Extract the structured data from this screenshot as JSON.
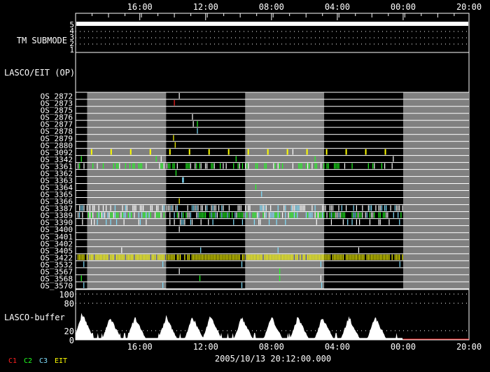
{
  "chart_data": {
    "type": "timeline",
    "x_unit": "hours from plot start",
    "xlim": [
      0,
      23.9
    ],
    "time_ticks": [
      {
        "label": "16:00",
        "hours": 3.9
      },
      {
        "label": "12:00",
        "hours": 7.9
      },
      {
        "label": "08:00",
        "hours": 11.9
      },
      {
        "label": "04:00",
        "hours": 15.9
      },
      {
        "label": "00:00",
        "hours": 19.9
      },
      {
        "label": "20:00",
        "hours": 23.9
      }
    ],
    "footer_time": "2005/10/13 20:12:00.000",
    "legend": [
      {
        "label": "C1",
        "color": "#ff2020"
      },
      {
        "label": "C2",
        "color": "#20ff20"
      },
      {
        "label": "C3",
        "color": "#80e0ff"
      },
      {
        "label": "EIT",
        "color": "#ffff00"
      }
    ],
    "shaded_intervals": [
      [
        0.7,
        5.5
      ],
      [
        10.3,
        15.1
      ],
      [
        19.9,
        23.9
      ]
    ],
    "submode": {
      "label": "TM SUBMODE",
      "ticks": [
        "5",
        "4",
        "3",
        "2",
        "1"
      ],
      "value": 5
    },
    "op_label": "LASCO/EIT (OP)",
    "rows": [
      {
        "name": "OS_2872",
        "events": [
          [
            6.3,
            "#ffffff"
          ]
        ]
      },
      {
        "name": "OS_2873",
        "events": [
          [
            6.0,
            "#ff2020"
          ]
        ]
      },
      {
        "name": "OS_2875",
        "events": []
      },
      {
        "name": "OS_2876",
        "events": [
          [
            7.1,
            "#ffffff"
          ]
        ]
      },
      {
        "name": "OS_2877",
        "events": [
          [
            7.4,
            "#20ff20"
          ],
          [
            7.15,
            "#ffffff"
          ]
        ]
      },
      {
        "name": "OS_2878",
        "events": [
          [
            7.4,
            "#80e0ff"
          ]
        ]
      },
      {
        "name": "OS_2879",
        "events": [
          [
            5.95,
            "#ffff00"
          ]
        ]
      },
      {
        "name": "OS_2880",
        "events": [
          [
            6.05,
            "#ffff00"
          ]
        ]
      },
      {
        "name": "OS_3092",
        "periodic": {
          "start": 0.97,
          "step": 1.19,
          "end": 19.0,
          "color": "#ffff00"
        },
        "events": [
          [
            4.55,
            "#ffffff"
          ],
          [
            13.2,
            "#ffffff"
          ]
        ]
      },
      {
        "name": "OS_3342",
        "events": [
          [
            0.35,
            "#20ff20"
          ],
          [
            4.9,
            "#20ff20"
          ],
          [
            5.2,
            "#ffffff"
          ],
          [
            9.75,
            "#20ff20"
          ],
          [
            14.55,
            "#20ff20"
          ],
          [
            19.3,
            "#ffffff"
          ]
        ]
      },
      {
        "name": "OS_3361",
        "dense": {
          "end": 19.4,
          "density": 0.45,
          "colors": [
            "#20ff20",
            "#20ff20",
            "#ffffff"
          ]
        }
      },
      {
        "name": "OS_3362",
        "events": [
          [
            6.1,
            "#20ff20"
          ]
        ]
      },
      {
        "name": "OS_3363",
        "events": [
          [
            6.5,
            "#80e0ff"
          ],
          [
            6.55,
            "#80e0ff"
          ]
        ]
      },
      {
        "name": "OS_3364",
        "events": [
          [
            10.95,
            "#20ff20"
          ]
        ]
      },
      {
        "name": "OS_3365",
        "events": [
          [
            11.3,
            "#80e0ff"
          ]
        ]
      },
      {
        "name": "OS_3366",
        "events": [
          [
            6.3,
            "#ffff00"
          ]
        ]
      },
      {
        "name": "OS_3387",
        "dense": {
          "end": 19.9,
          "density": 0.55,
          "colors": [
            "#ffffff",
            "#80e0ff",
            "#ffffff"
          ]
        }
      },
      {
        "name": "OS_3389",
        "dense": {
          "end": 19.9,
          "density": 0.7,
          "colors": [
            "#20ff20",
            "#20ff20",
            "#80e0ff",
            "#ffffff"
          ]
        }
      },
      {
        "name": "OS_3390",
        "dense": {
          "end": 19.9,
          "density": 0.2,
          "colors": [
            "#80e0ff",
            "#ffffff"
          ]
        }
      },
      {
        "name": "OS_3400",
        "events": [
          [
            6.3,
            "#ffffff"
          ]
        ]
      },
      {
        "name": "OS_3401",
        "events": []
      },
      {
        "name": "OS_3402",
        "events": []
      },
      {
        "name": "OS_3405",
        "events": [
          [
            2.8,
            "#ffffff"
          ],
          [
            7.6,
            "#80e0ff"
          ],
          [
            12.3,
            "#80e0ff"
          ],
          [
            17.2,
            "#ffffff"
          ]
        ]
      },
      {
        "name": "OS_3422",
        "dense": {
          "end": 19.9,
          "density": 0.9,
          "colors": [
            "#ffff00"
          ]
        }
      },
      {
        "name": "OS_3532",
        "events": [
          [
            0.5,
            "#80e0ff"
          ],
          [
            5.3,
            "#80e0ff"
          ],
          [
            10.1,
            "#80e0ff"
          ],
          [
            14.9,
            "#80e0ff"
          ],
          [
            19.7,
            "#80e0ff"
          ]
        ]
      },
      {
        "name": "OS_3567",
        "events": [
          [
            6.3,
            "#ffffff"
          ],
          [
            12.4,
            "#20ff20"
          ]
        ]
      },
      {
        "name": "OS_3568",
        "events": [
          [
            0.35,
            "#20ff20"
          ],
          [
            7.55,
            "#20ff20"
          ],
          [
            12.4,
            "#20ff20"
          ],
          [
            14.9,
            "#ffffff"
          ]
        ]
      },
      {
        "name": "OS_3570",
        "events": [
          [
            0.5,
            "#80e0ff"
          ],
          [
            5.3,
            "#80e0ff"
          ],
          [
            10.1,
            "#80e0ff"
          ],
          [
            14.95,
            "#80e0ff"
          ]
        ]
      }
    ],
    "buffer": {
      "label": "LASCO-buffer",
      "ylim": [
        0,
        110
      ],
      "yticks": [
        "100",
        "80",
        "20",
        "0"
      ],
      "ytick_values": [
        100,
        80,
        20,
        0
      ],
      "peaks_hours": [
        0.4,
        2.1,
        3.6,
        5.5,
        7.1,
        8.2,
        10.1,
        11.9,
        13.5,
        15.0,
        16.6,
        18.2
      ],
      "peak_values": [
        67,
        55,
        55,
        55,
        55,
        60,
        55,
        55,
        55,
        55,
        55,
        55
      ],
      "end_hours": 19.9
    }
  }
}
